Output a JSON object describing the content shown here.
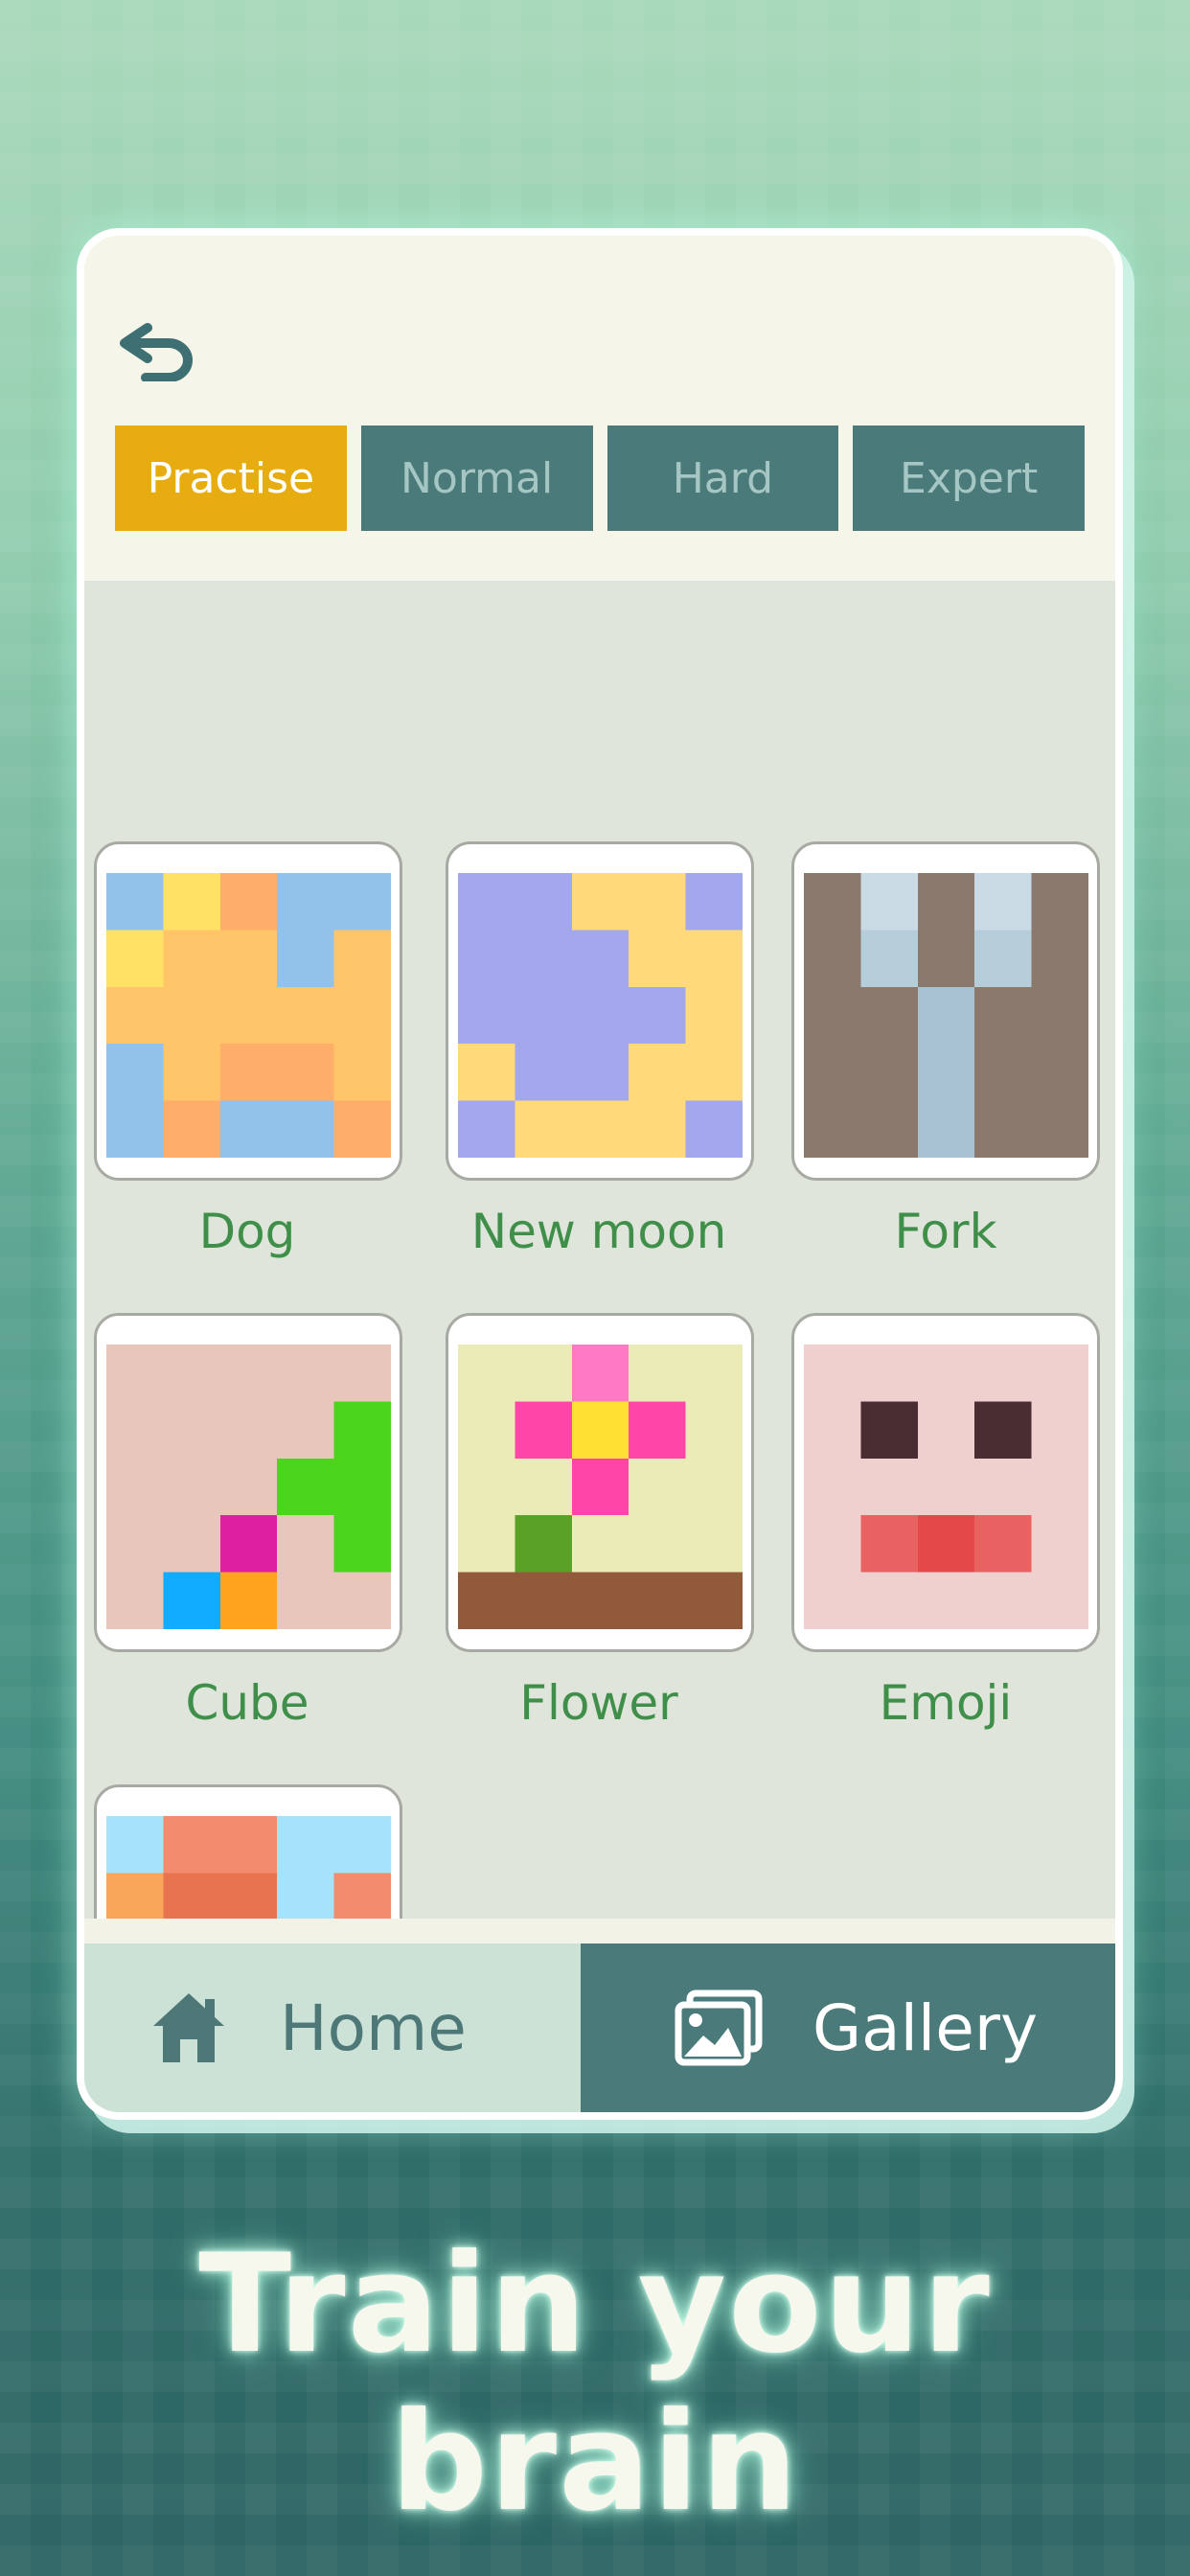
{
  "header": {
    "back_icon": "undo-arrow-icon",
    "tabs": [
      {
        "label": "Practise",
        "active": true
      },
      {
        "label": "Normal",
        "active": false
      },
      {
        "label": "Hard",
        "active": false
      },
      {
        "label": "Expert",
        "active": false
      }
    ]
  },
  "gallery": {
    "items": [
      {
        "label": "Dog"
      },
      {
        "label": "New moon"
      },
      {
        "label": "Fork"
      },
      {
        "label": "Cube"
      },
      {
        "label": "Flower"
      },
      {
        "label": "Emoji"
      },
      {
        "label": ""
      }
    ]
  },
  "nav": {
    "home_label": "Home",
    "home_icon": "home-icon",
    "gallery_label": "Gallery",
    "gallery_icon": "image-icon"
  },
  "headline": "Train your brain",
  "colors": {
    "accent_tab": "#e7ad10",
    "tab": "#4a7a79",
    "label_green": "#3f8f4a"
  }
}
